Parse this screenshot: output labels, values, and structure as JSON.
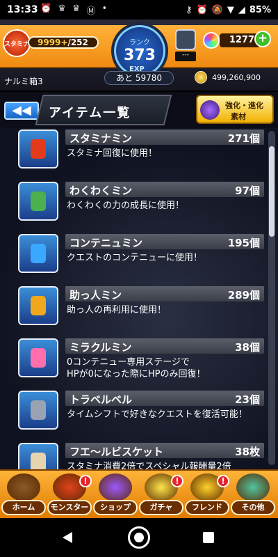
{
  "status_bar": {
    "time": "13:33",
    "left_icons": [
      "alarm-icon",
      "game-icon",
      "game-icon",
      "m-icon",
      "dot-icon"
    ],
    "battery": "85%"
  },
  "header": {
    "stamina_label": "スタミナ",
    "stamina_current": "9999+",
    "stamina_max": "/252",
    "rank_label": "ランク",
    "rank_value": "373",
    "exp_label": "EXP",
    "exp_remaining": "あと 59780",
    "box_label": "---",
    "orb_count": "1277",
    "plus_label": "+",
    "player_name": "ナルミ箱3",
    "coin_count": "499,260,900"
  },
  "title_row": {
    "back_label": "◀◀",
    "title": "アイテム一覧",
    "evo_line1": "強化・進化",
    "evo_line2": "素材"
  },
  "items": [
    {
      "name": "スタミナミン",
      "count": "271個",
      "desc": "スタミナ回復に使用！",
      "icon": "stamina-can-icon",
      "color": "#e23a1a"
    },
    {
      "name": "わくわくミン",
      "count": "97個",
      "desc": "わくわくの力の成長に使用！",
      "icon": "bottle-icon",
      "color": "#4caf50"
    },
    {
      "name": "コンテニュミン",
      "count": "195個",
      "desc": "クエストのコンテニューに使用！",
      "icon": "potion-icon",
      "color": "#3aa8ff"
    },
    {
      "name": "助っ人ミン",
      "count": "289個",
      "desc": "助っ人の再利用に使用！",
      "icon": "helper-piece-icon",
      "color": "#f2a81d"
    },
    {
      "name": "ミラクルミン",
      "count": "38個",
      "desc": "0コンテニュー専用ステージで\nHPが0になった際にHPのみ回復！",
      "icon": "heart-potion-icon",
      "color": "#ff6fae"
    },
    {
      "name": "トラベルベル",
      "count": "23個",
      "desc": "タイムシフトで好きなクエストを復活可能！",
      "icon": "bell-icon",
      "color": "#9aa3b3"
    },
    {
      "name": "フエ～ルビスケット",
      "count": "38枚",
      "desc": "スタミナ消費2倍でスペシャル報酬量2倍",
      "icon": "biscuit-icon",
      "color": "#e6d3b0"
    }
  ],
  "bottom_nav": [
    {
      "label": "ホーム",
      "icon": "home-icon",
      "color": "#8a5a2b",
      "badge": ""
    },
    {
      "label": "モンスター",
      "icon": "monster-icon",
      "color": "#e2421e",
      "badge": "!"
    },
    {
      "label": "ショップ",
      "icon": "orb-icon",
      "color": "#9b59ff",
      "badge": ""
    },
    {
      "label": "ガチャ",
      "icon": "gacha-icon",
      "color": "#ffe54a",
      "badge": "!"
    },
    {
      "label": "フレンド",
      "icon": "friend-icon",
      "color": "#ffd02a",
      "badge": "!"
    },
    {
      "label": "その他",
      "icon": "other-icon",
      "color": "#4fc3a0",
      "badge": ""
    }
  ]
}
